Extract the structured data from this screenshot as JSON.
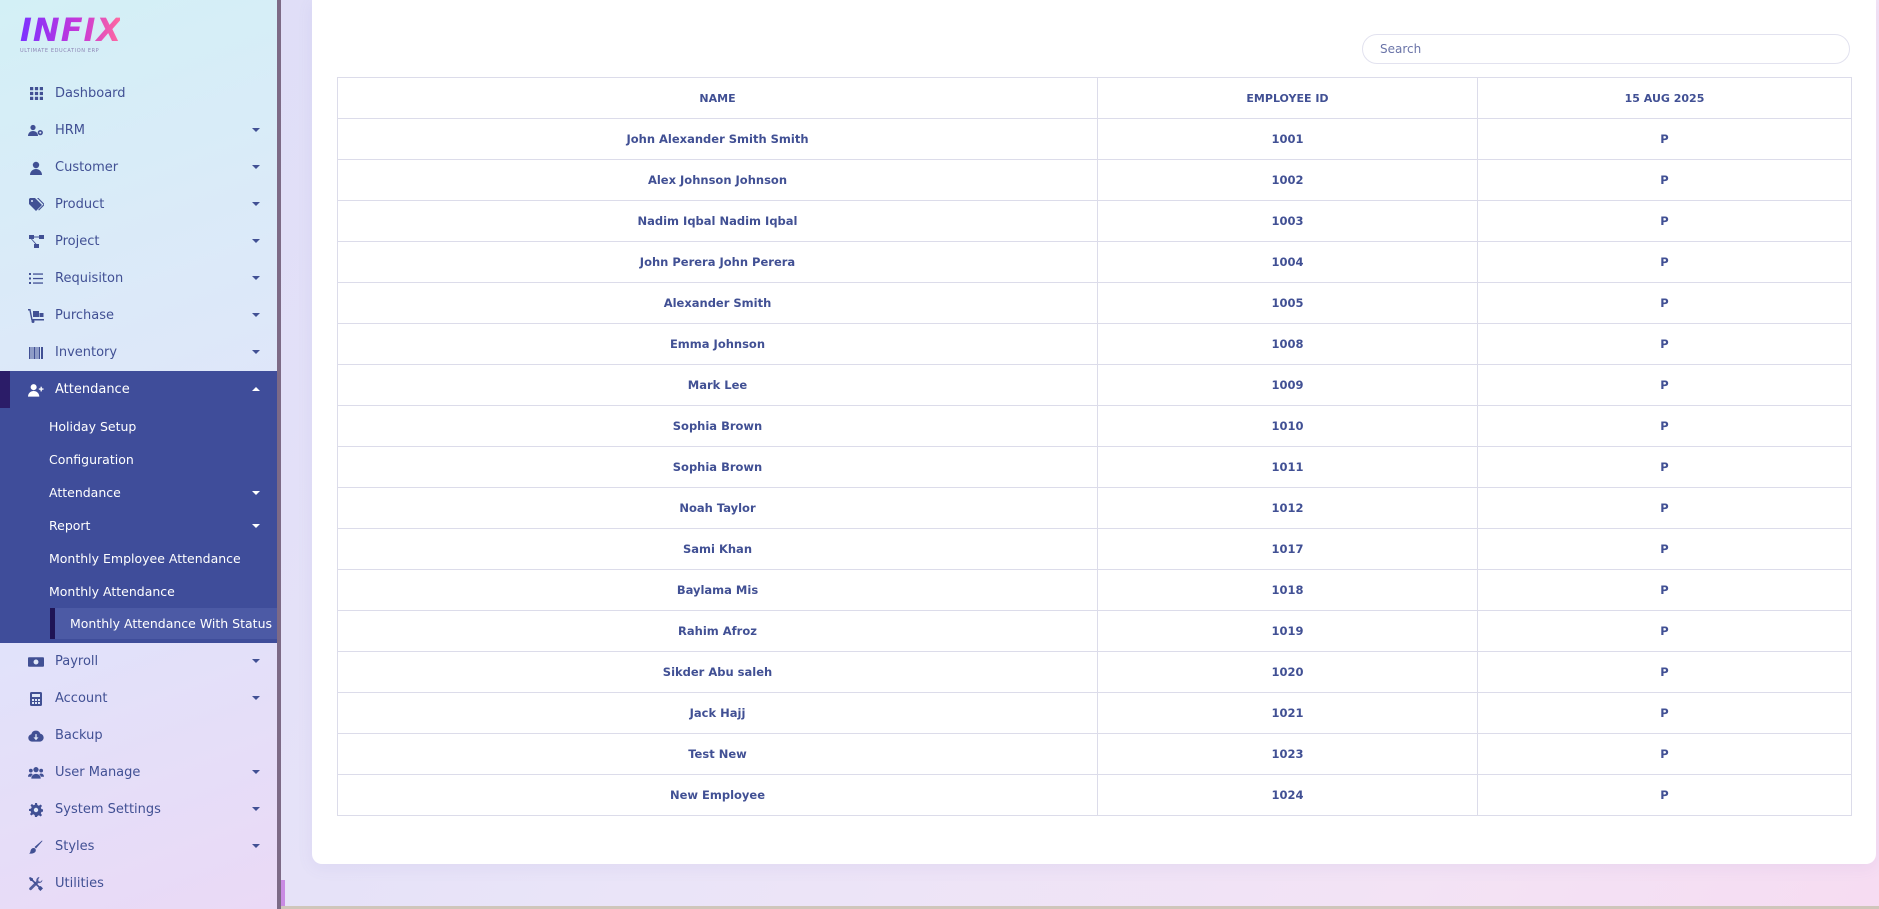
{
  "brand": {
    "logo": "INFIX",
    "tagline": "ULTIMATE EDUCATION ERP"
  },
  "sidebar": {
    "items": [
      {
        "label": "Dashboard",
        "icon": "dashboard-grid-icon",
        "has_caret": false
      },
      {
        "label": "HRM",
        "icon": "users-cog-icon",
        "has_caret": true
      },
      {
        "label": "Customer",
        "icon": "user-tie-icon",
        "has_caret": true
      },
      {
        "label": "Product",
        "icon": "tags-icon",
        "has_caret": true
      },
      {
        "label": "Project",
        "icon": "project-diagram-icon",
        "has_caret": true
      },
      {
        "label": "Requisiton",
        "icon": "list-check-icon",
        "has_caret": true
      },
      {
        "label": "Purchase",
        "icon": "dolly-cart-icon",
        "has_caret": true
      },
      {
        "label": "Inventory",
        "icon": "barcode-icon",
        "has_caret": true
      },
      {
        "label": "Attendance",
        "icon": "user-plus-icon",
        "has_caret": true,
        "active": true
      }
    ],
    "attendance_submenu": [
      {
        "label": "Holiday Setup",
        "has_caret": false
      },
      {
        "label": "Configuration",
        "has_caret": false
      },
      {
        "label": "Attendance",
        "has_caret": true
      },
      {
        "label": "Report",
        "has_caret": true
      },
      {
        "label": "Monthly Employee Attendance",
        "has_caret": false
      },
      {
        "label": "Monthly Attendance",
        "has_caret": false
      },
      {
        "label": "Monthly Attendance With Status",
        "has_caret": false,
        "current": true
      }
    ],
    "items_after": [
      {
        "label": "Payroll",
        "icon": "money-icon",
        "has_caret": true
      },
      {
        "label": "Account",
        "icon": "calculator-icon",
        "has_caret": true
      },
      {
        "label": "Backup",
        "icon": "cloud-download-icon",
        "has_caret": false
      },
      {
        "label": "User Manage",
        "icon": "users-icon",
        "has_caret": true
      },
      {
        "label": "System Settings",
        "icon": "gear-icon",
        "has_caret": true
      },
      {
        "label": "Styles",
        "icon": "paint-brush-icon",
        "has_caret": true
      },
      {
        "label": "Utilities",
        "icon": "tools-icon",
        "has_caret": false
      }
    ]
  },
  "search": {
    "placeholder": "Search",
    "value": ""
  },
  "table": {
    "columns": [
      "NAME",
      "EMPLOYEE ID",
      "15 AUG 2025"
    ],
    "rows": [
      [
        "John Alexander Smith Smith",
        "1001",
        "P"
      ],
      [
        "Alex Johnson Johnson",
        "1002",
        "P"
      ],
      [
        "Nadim Iqbal Nadim Iqbal",
        "1003",
        "P"
      ],
      [
        "John Perera John Perera",
        "1004",
        "P"
      ],
      [
        "Alexander Smith",
        "1005",
        "P"
      ],
      [
        "Emma Johnson",
        "1008",
        "P"
      ],
      [
        "Mark Lee",
        "1009",
        "P"
      ],
      [
        "Sophia Brown",
        "1010",
        "P"
      ],
      [
        "Sophia Brown",
        "1011",
        "P"
      ],
      [
        "Noah Taylor",
        "1012",
        "P"
      ],
      [
        "Sami Khan",
        "1017",
        "P"
      ],
      [
        "Baylama Mis",
        "1018",
        "P"
      ],
      [
        "Rahim Afroz",
        "1019",
        "P"
      ],
      [
        "Sikder Abu saleh",
        "1020",
        "P"
      ],
      [
        "Jack Hajj",
        "1021",
        "P"
      ],
      [
        "Test New",
        "1023",
        "P"
      ],
      [
        "New Employee",
        "1024",
        "P"
      ]
    ]
  },
  "colors": {
    "primary": "#415094",
    "active_bg": "#3f4d9a",
    "accent": "#7c32ff"
  }
}
